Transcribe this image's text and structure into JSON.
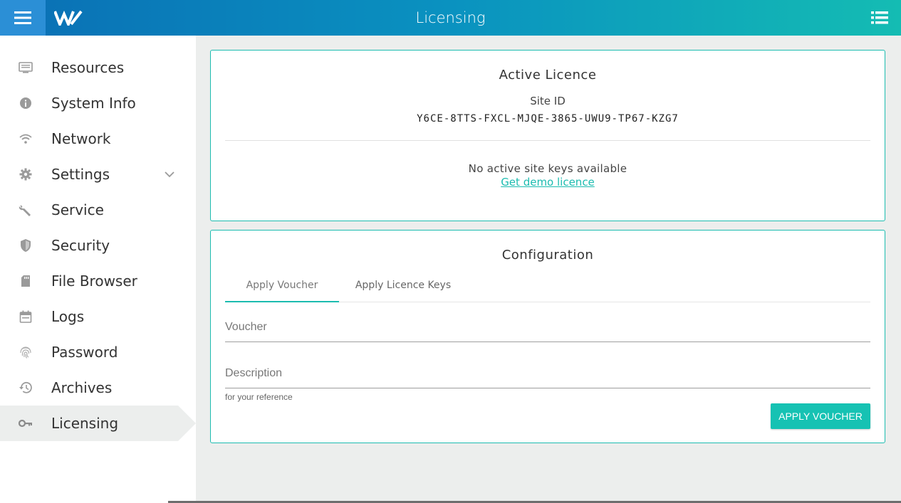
{
  "header": {
    "title": "Licensing",
    "menu_icon": "hamburger-icon",
    "logo_icon": "brand-logo",
    "list_icon": "list-icon"
  },
  "colors": {
    "accent": "#1cbcb0",
    "header_start": "#0a6fb5",
    "header_end": "#14bcb3",
    "active_bg": "#eceeed"
  },
  "sidebar": {
    "items": [
      {
        "label": "Resources",
        "icon": "monitor-icon"
      },
      {
        "label": "System Info",
        "icon": "info-icon"
      },
      {
        "label": "Network",
        "icon": "wifi-icon"
      },
      {
        "label": "Settings",
        "icon": "gear-icon",
        "expandable": true
      },
      {
        "label": "Service",
        "icon": "wrench-icon"
      },
      {
        "label": "Security",
        "icon": "shield-icon"
      },
      {
        "label": "File Browser",
        "icon": "sd-card-icon"
      },
      {
        "label": "Logs",
        "icon": "calendar-icon"
      },
      {
        "label": "Password",
        "icon": "fingerprint-icon"
      },
      {
        "label": "Archives",
        "icon": "history-icon"
      },
      {
        "label": "Licensing",
        "icon": "key-icon",
        "active": true
      }
    ]
  },
  "active_licence": {
    "title": "Active Licence",
    "site_id_label": "Site ID",
    "site_id_value": "Y6CE-8TTS-FXCL-MJQE-3865-UWU9-TP67-KZG7",
    "no_keys_text": "No active site keys available",
    "demo_link_text": "Get demo licence"
  },
  "configuration": {
    "title": "Configuration",
    "tabs": [
      {
        "label": "Apply Voucher",
        "active": true
      },
      {
        "label": "Apply Licence Keys",
        "active": false
      }
    ],
    "voucher_placeholder": "Voucher",
    "voucher_value": "",
    "description_placeholder": "Description",
    "description_value": "",
    "description_hint": "for your reference",
    "apply_button_label": "APPLY VOUCHER"
  }
}
